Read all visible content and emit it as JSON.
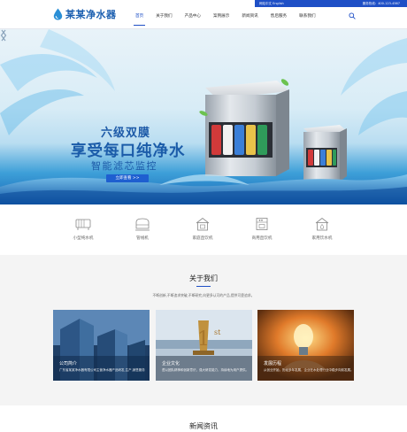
{
  "header": {
    "logo_text": "某某净水器",
    "lang_label": "网站中文 English",
    "phone_label": "服务热线：400-123-4567",
    "nav": [
      {
        "label": "首页",
        "active": true
      },
      {
        "label": "关于我们",
        "active": false
      },
      {
        "label": "产品中心",
        "active": false
      },
      {
        "label": "案例展示",
        "active": false
      },
      {
        "label": "新闻资讯",
        "active": false
      },
      {
        "label": "售后服务",
        "active": false
      },
      {
        "label": "联系我们",
        "active": false
      }
    ]
  },
  "banner": {
    "line1": "六级双膜",
    "line2": "享受每口纯净水",
    "line3": "智能滤芯监控",
    "cta": "立即查看 >>"
  },
  "categories": [
    {
      "label": "小型纯水机",
      "icon": "water-purifier-icon"
    },
    {
      "label": "管线机",
      "icon": "pipeline-machine-icon"
    },
    {
      "label": "家庭直饮机",
      "icon": "home-drinker-icon"
    },
    {
      "label": "商用直饮机",
      "icon": "commercial-drinker-icon"
    },
    {
      "label": "家用饮水机",
      "icon": "water-dispenser-icon"
    }
  ],
  "about": {
    "title": "关于我们",
    "desc": "不断创新,不断追求突破,不断研究,向更多认可的产品,提供可靠追求。",
    "cards": [
      {
        "title": "公司简介",
        "text": "广东省某某净水器有限公司主营净水器产品研发,生产,销售服务"
      },
      {
        "title": "企业文化",
        "text": "遵以团队精神和创新意识，强大研发能力，持续地为用户提供。"
      },
      {
        "title": "发展历程",
        "text": "从创业开始，历经多年发展，企业在水处理行业中稳步向前发展。"
      }
    ]
  },
  "news": {
    "title": "新闻资讯"
  },
  "colors": {
    "accent": "#1e4fc6",
    "logo": "#1b5fb0",
    "section_bg": "#f4f4f4"
  }
}
